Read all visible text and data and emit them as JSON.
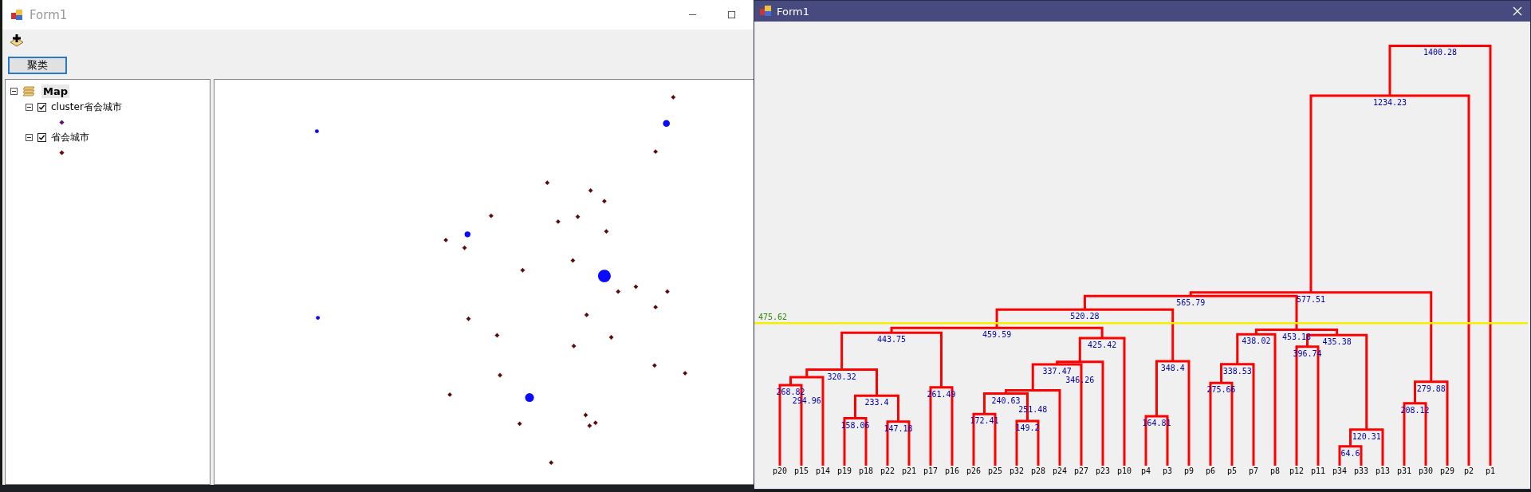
{
  "left_window": {
    "title": "Form1",
    "button": "聚类",
    "tree": {
      "label": "Map",
      "expanded": true,
      "selected": true,
      "children": [
        {
          "label": "cluster省会城市",
          "checked": true,
          "expanded": true,
          "color": "#5b1670"
        },
        {
          "label": "省会城市",
          "checked": true,
          "expanded": true,
          "color": "#6e0a0a"
        }
      ]
    }
  },
  "right_window": {
    "title": "Form1",
    "dendrogram": {
      "threshold": "475.62",
      "root": {
        "label": "1400.28",
        "children": [
          {
            "label": "1234.23",
            "children": [
              {
                "label": "577.51",
                "children": [
                  {
                    "label": "565.79",
                    "children": [
                      {
                        "label": "520.28",
                        "children": [
                          {
                            "label": "459.59",
                            "children": [
                              {
                                "label": "443.75",
                                "children": [
                                  {
                                    "label": "320.32",
                                    "children": [
                                      {
                                        "label": "294.96",
                                        "children": [
                                          {
                                            "label": "268.82",
                                            "children": [
                                              {
                                                "label": "p20"
                                              },
                                              {
                                                "label": "p15"
                                              }
                                            ]
                                          },
                                          {
                                            "label": "p14"
                                          }
                                        ]
                                      },
                                      {
                                        "label": "233.4",
                                        "children": [
                                          {
                                            "label": "158.06",
                                            "children": [
                                              {
                                                "label": "p19"
                                              },
                                              {
                                                "label": "p18"
                                              }
                                            ]
                                          },
                                          {
                                            "label": "147.18",
                                            "children": [
                                              {
                                                "label": "p22"
                                              },
                                              {
                                                "label": "p21"
                                              }
                                            ]
                                          }
                                        ]
                                      }
                                    ]
                                  },
                                  {
                                    "label": "261.49",
                                    "children": [
                                      {
                                        "label": "p17"
                                      },
                                      {
                                        "label": "p16"
                                      }
                                    ]
                                  }
                                ]
                              },
                              {
                                "label": "425.42",
                                "children": [
                                  {
                                    "label": "346.26",
                                    "children": [
                                      {
                                        "label": "337.47",
                                        "children": [
                                          {
                                            "label": "251.48",
                                            "children": [
                                              {
                                                "label": "240.63",
                                                "children": [
                                                  {
                                                    "label": "172.41",
                                                    "children": [
                                                      {
                                                        "label": "p26"
                                                      },
                                                      {
                                                        "label": "p25"
                                                      }
                                                    ]
                                                  },
                                                  {
                                                    "label": "149.2",
                                                    "children": [
                                                      {
                                                        "label": "p32"
                                                      },
                                                      {
                                                        "label": "p28"
                                                      }
                                                    ]
                                                  }
                                                ]
                                              },
                                              {
                                                "label": "p24"
                                              }
                                            ]
                                          },
                                          {
                                            "label": "p27"
                                          }
                                        ]
                                      },
                                      {
                                        "label": "p23"
                                      }
                                    ]
                                  },
                                  {
                                    "label": "p10"
                                  }
                                ]
                              }
                            ]
                          },
                          {
                            "label": "348.4",
                            "children": [
                              {
                                "label": "164.81",
                                "children": [
                                  {
                                    "label": "p4"
                                  },
                                  {
                                    "label": "p3"
                                  }
                                ]
                              },
                              {
                                "label": "p9"
                              }
                            ]
                          }
                        ]
                      },
                      {
                        "label": "453.18",
                        "children": [
                          {
                            "label": "438.02",
                            "children": [
                              {
                                "label": "338.53",
                                "children": [
                                  {
                                    "label": "275.66",
                                    "children": [
                                      {
                                        "label": "p6"
                                      },
                                      {
                                        "label": "p5"
                                      }
                                    ]
                                  },
                                  {
                                    "label": "p7"
                                  }
                                ]
                              },
                              {
                                "label": "p8"
                              }
                            ]
                          },
                          {
                            "label": "435.38",
                            "children": [
                              {
                                "label": "396.74",
                                "children": [
                                  {
                                    "label": "p12"
                                  },
                                  {
                                    "label": "p11"
                                  }
                                ]
                              },
                              {
                                "label": "120.31",
                                "children": [
                                  {
                                    "label": "64.6",
                                    "children": [
                                      {
                                        "label": "p34"
                                      },
                                      {
                                        "label": "p33"
                                      }
                                    ]
                                  },
                                  {
                                    "label": "p13"
                                  }
                                ]
                              }
                            ]
                          }
                        ]
                      }
                    ]
                  },
                  {
                    "label": "279.88",
                    "children": [
                      {
                        "label": "208.12",
                        "children": [
                          {
                            "label": "p31"
                          },
                          {
                            "label": "p30"
                          }
                        ]
                      },
                      {
                        "label": "p29"
                      }
                    ]
                  }
                ]
              },
              {
                "label": "p2"
              }
            ]
          },
          {
            "label": "p1"
          }
        ]
      }
    }
  }
}
